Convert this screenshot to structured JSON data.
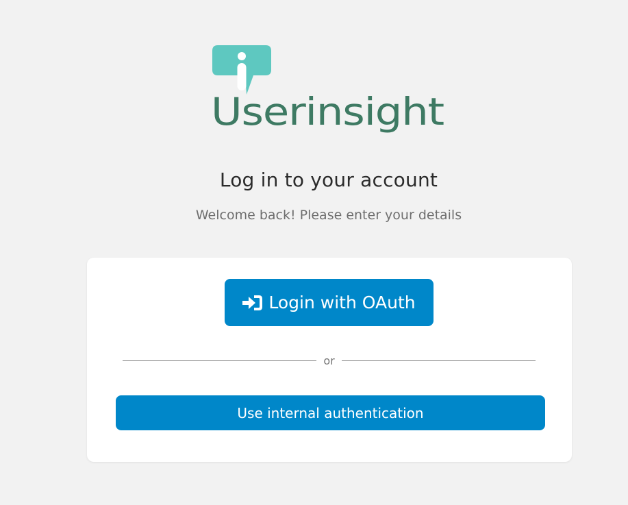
{
  "brand": {
    "name": "Userinsight",
    "logo_icon": "info-speech-bubble-icon",
    "colors": {
      "bubble": "#5ec8c0",
      "wordmark": "#3e7a63"
    }
  },
  "heading": "Log in to your account",
  "subheading": "Welcome back! Please enter your details",
  "login": {
    "oauth_icon": "sign-in-icon",
    "oauth_label": "Login with OAuth",
    "divider_label": "or",
    "internal_label": "Use internal authentication"
  },
  "colors": {
    "background": "#f2f2f2",
    "card": "#ffffff",
    "primary": "#0087c9",
    "heading_text": "#2b2b2b",
    "muted_text": "#6e6e6e"
  }
}
